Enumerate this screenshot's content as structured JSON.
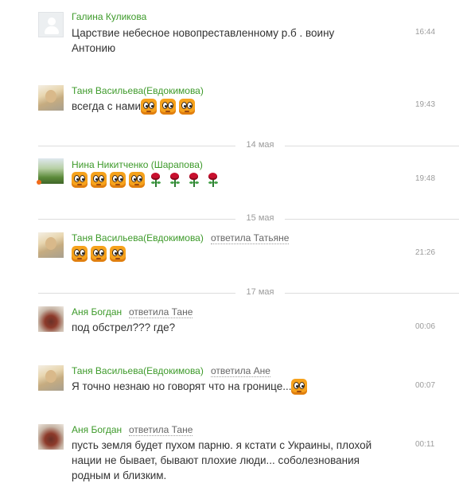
{
  "messages": [
    {
      "author": "Галина Куликова",
      "text": "Царствие небесное новопреставленному р.б . воину Антонию",
      "time": "16:44"
    },
    {
      "author": "Таня Васильева(Евдокимова)",
      "text": "всегда с нами",
      "time": "19:43",
      "emoticons": [
        "smiley-face-icon",
        "smiley-face-icon",
        "smiley-face-icon"
      ]
    },
    {
      "author": "Нина Никитченко (Шарапова)",
      "text": "",
      "time": "19:48",
      "emoticons": [
        "smiley-face-icon",
        "smiley-face-icon",
        "smiley-face-icon",
        "smiley-face-icon",
        "rose-icon",
        "rose-icon",
        "rose-icon",
        "rose-icon"
      ]
    },
    {
      "author": "Таня Васильева(Евдокимова)",
      "reply_to": "ответила Татьяне",
      "text": "",
      "time": "21:26",
      "emoticons": [
        "smiley-face-icon",
        "smiley-face-icon",
        "smiley-face-icon"
      ]
    },
    {
      "author": "Аня Богдан",
      "reply_to": "ответила Тане",
      "text": "под обстрел??? где?",
      "time": "00:06"
    },
    {
      "author": "Таня Васильева(Евдокимова)",
      "reply_to": "ответила Ане",
      "text": "Я точно незнаю но говорят что на гронице...",
      "time": "00:07",
      "emoticons": [
        "smiley-face-icon"
      ]
    },
    {
      "author": "Аня Богдан",
      "reply_to": "ответила Тане",
      "text": "пусть земля будет пухом парню. я кстати с Украины, плохой нации не бывает, бывают плохие люди... соболезнования родным и близким.",
      "time": "00:11"
    }
  ],
  "date_separators": [
    "14 мая",
    "15 мая",
    "17 мая"
  ],
  "colors": {
    "author": "#3d9a2a",
    "text": "#333333",
    "meta": "#9b9b9b",
    "divider": "#dddddd",
    "online": "#f06a1a"
  }
}
